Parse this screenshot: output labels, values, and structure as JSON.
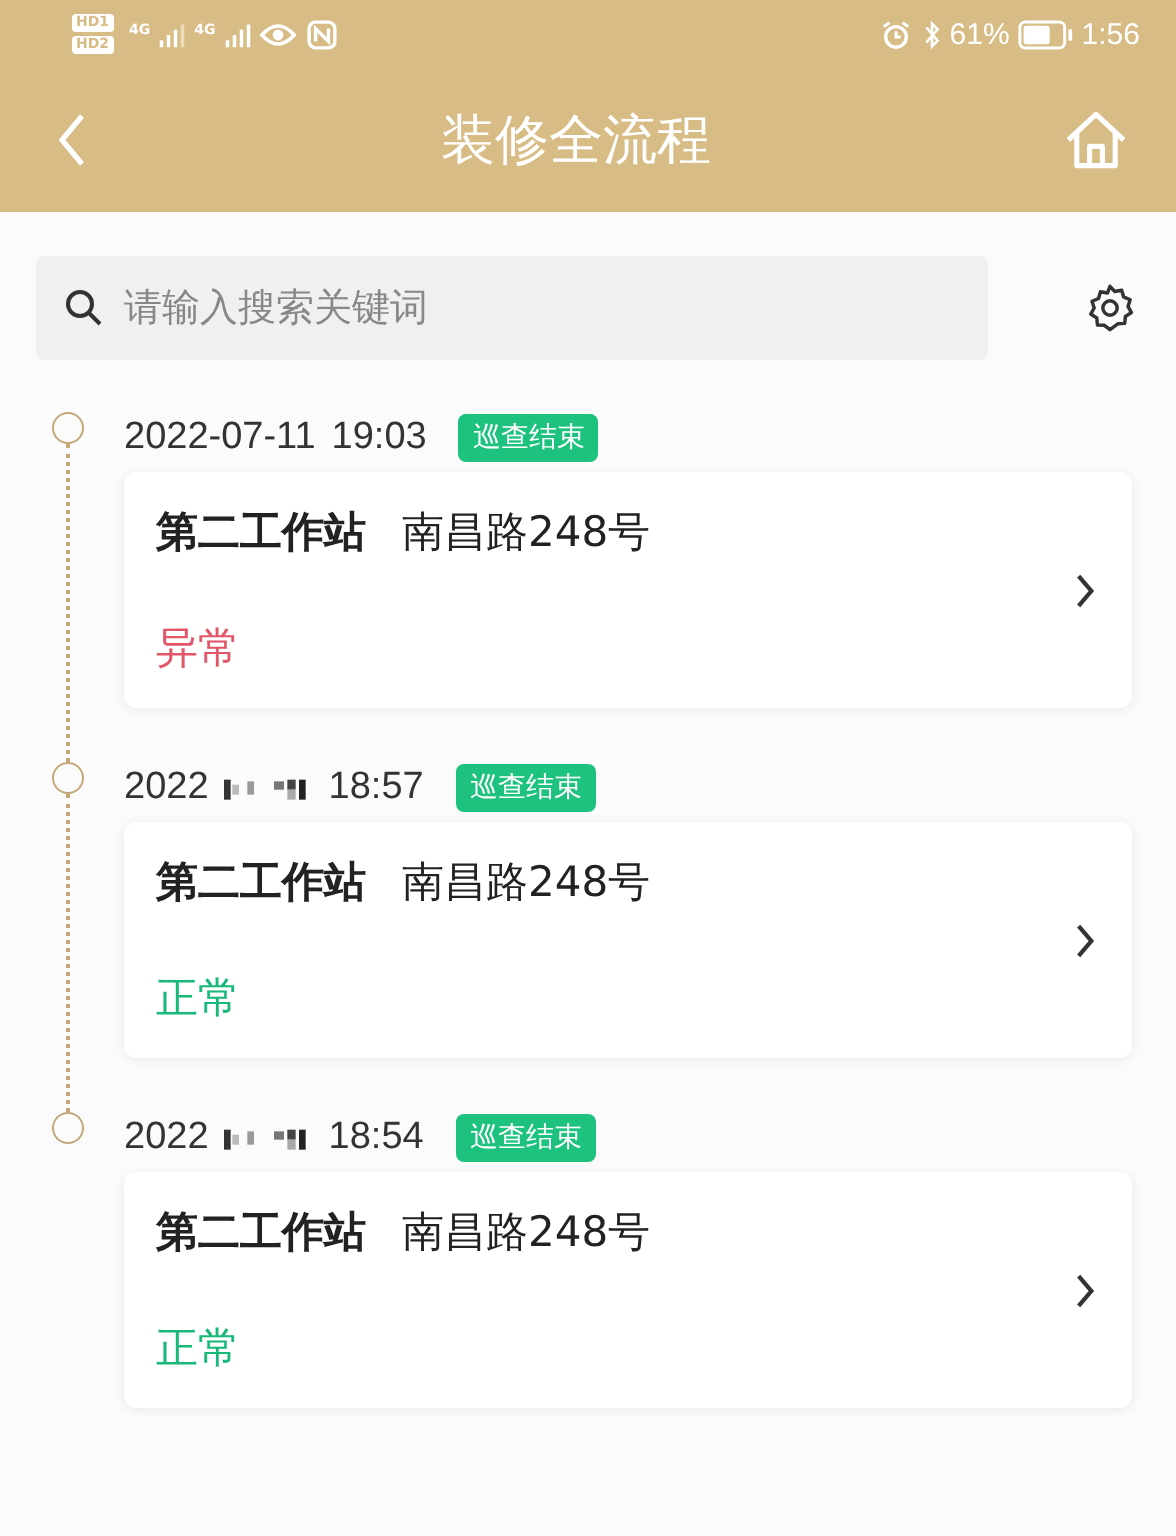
{
  "status_bar": {
    "sim_labels": [
      "HD1",
      "HD2"
    ],
    "network_labels": [
      "4G",
      "4G"
    ],
    "battery": "61%",
    "time": "1:56"
  },
  "nav": {
    "title": "装修全流程"
  },
  "search": {
    "placeholder": "请输入搜索关键词"
  },
  "entries": [
    {
      "date": "2022-07-11",
      "time": "19:03",
      "redacted": false,
      "badge": "巡查结束",
      "station": "第二工作站",
      "address": "南昌路248号",
      "status": "异常",
      "color": "#e2566a"
    },
    {
      "date": "2022",
      "time": "18:57",
      "redacted": true,
      "badge": "巡查结束",
      "station": "第二工作站",
      "address": "南昌路248号",
      "status": "正常",
      "color": "#18b878"
    },
    {
      "date": "2022",
      "time": "18:54",
      "redacted": true,
      "badge": "巡查结束",
      "station": "第二工作站",
      "address": "南昌路248号",
      "status": "正常",
      "color": "#18b878"
    }
  ]
}
